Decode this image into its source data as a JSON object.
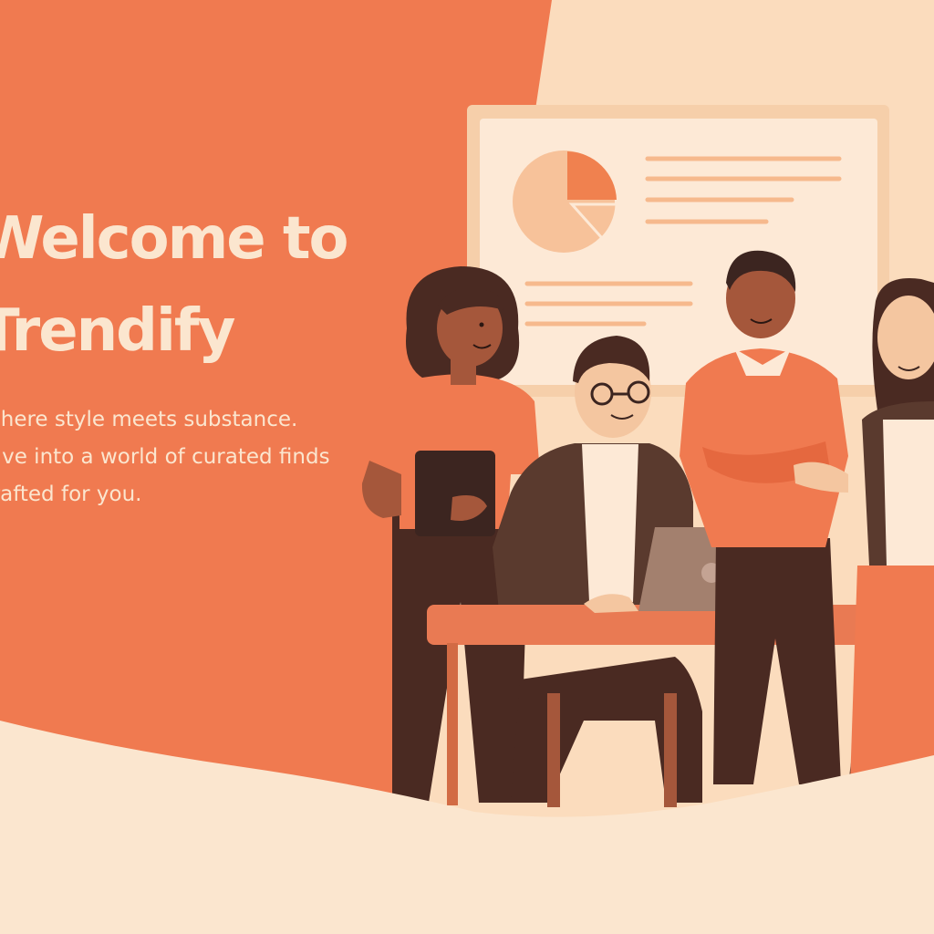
{
  "hero": {
    "title_line1": "Welcome to",
    "title_line2": "Trendify",
    "subtitle_line1": "Where style meets substance.",
    "subtitle_line2": "Dive into a world of curated finds",
    "subtitle_line3": "crafted for you."
  },
  "colors": {
    "accent_orange": "#f07a50",
    "cream": "#fbe6cf",
    "peach": "#fbdcbd",
    "dark_brown": "#4a2a22",
    "chart_orange": "#f0814f"
  }
}
